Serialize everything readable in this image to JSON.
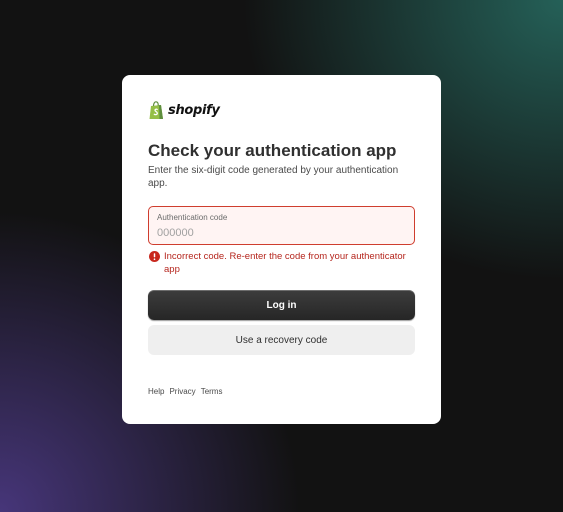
{
  "colors": {
    "accent_error": "#cf3d2e",
    "error_text": "#b5261e",
    "primary_button": "#303030",
    "secondary_button": "#efefef",
    "brand_green": "#95bf47"
  },
  "brand": {
    "name": "shopify",
    "logo_icon": "shopify-bag-icon"
  },
  "header": {
    "title": "Check your authentication app",
    "subtitle": "Enter the six-digit code generated by your authentication app."
  },
  "code_field": {
    "label": "Authentication code",
    "value": "",
    "placeholder": "000000"
  },
  "error": {
    "icon": "error-circle-icon",
    "message": "Incorrect code. Re-enter the code from your authenticator app"
  },
  "actions": {
    "login_label": "Log in",
    "recovery_label": "Use a recovery code"
  },
  "footer": {
    "links": [
      "Help",
      "Privacy",
      "Terms"
    ]
  }
}
